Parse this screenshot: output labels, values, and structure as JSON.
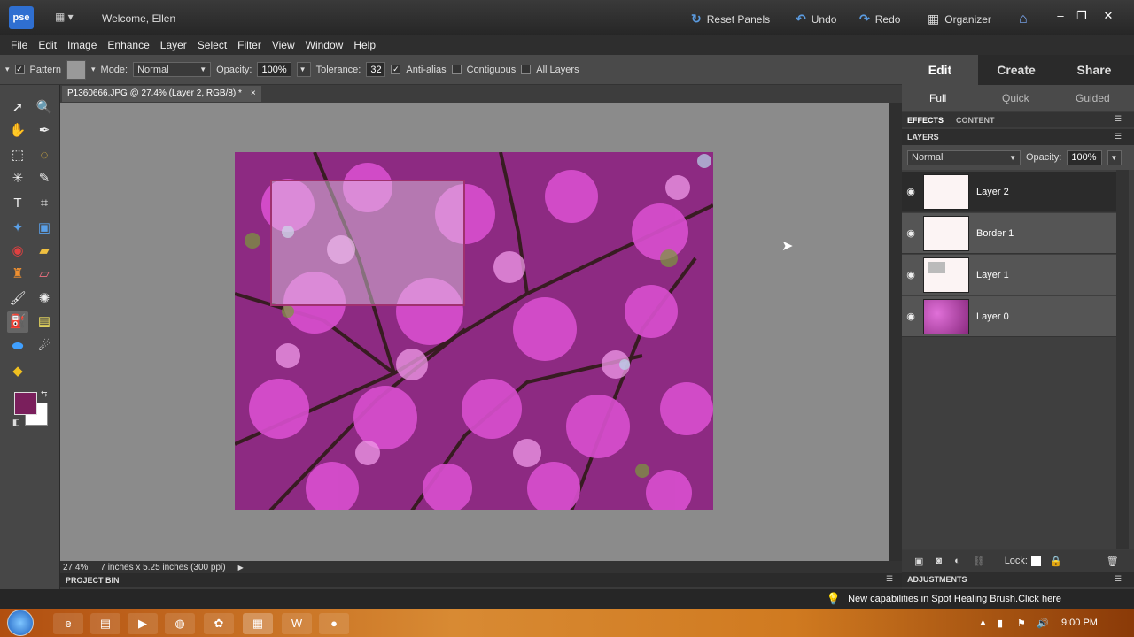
{
  "title_bar": {
    "logo": "pse",
    "welcome": "Welcome, Ellen",
    "reset_panels": "Reset Panels",
    "undo": "Undo",
    "redo": "Redo",
    "organizer": "Organizer"
  },
  "menu": [
    "File",
    "Edit",
    "Image",
    "Enhance",
    "Layer",
    "Select",
    "Filter",
    "View",
    "Window",
    "Help"
  ],
  "options": {
    "pattern_label": "Pattern",
    "mode_label": "Mode:",
    "mode_value": "Normal",
    "opacity_label": "Opacity:",
    "opacity_value": "100%",
    "tolerance_label": "Tolerance:",
    "tolerance_value": "32",
    "antialias_label": "Anti-alias",
    "contiguous_label": "Contiguous",
    "all_layers_label": "All Layers"
  },
  "document": {
    "tab_label": "P1360666.JPG @ 27.4% (Layer 2, RGB/8) *",
    "close": "×",
    "zoom": "27.4%",
    "size": "7 inches x 5.25 inches (300 ppi)"
  },
  "colors": {
    "foreground": "#7a1f5c",
    "background": "#ffffff"
  },
  "project_bin": "PROJECT BIN",
  "right_panel": {
    "mode_tabs": [
      "Edit",
      "Create",
      "Share"
    ],
    "sub_tabs": [
      "Full",
      "Quick",
      "Guided"
    ],
    "effects": "EFFECTS",
    "content": "CONTENT",
    "layers_header": "LAYERS",
    "blend_mode": "Normal",
    "opacity_label": "Opacity:",
    "opacity_value": "100%",
    "layers": [
      "Layer 2",
      "Border 1",
      "Layer 1",
      "Layer 0"
    ],
    "lock_label": "Lock:",
    "adjustments": "ADJUSTMENTS"
  },
  "hint": "New capabilities in Spot Healing Brush.Click here",
  "clock": "9:00 PM"
}
